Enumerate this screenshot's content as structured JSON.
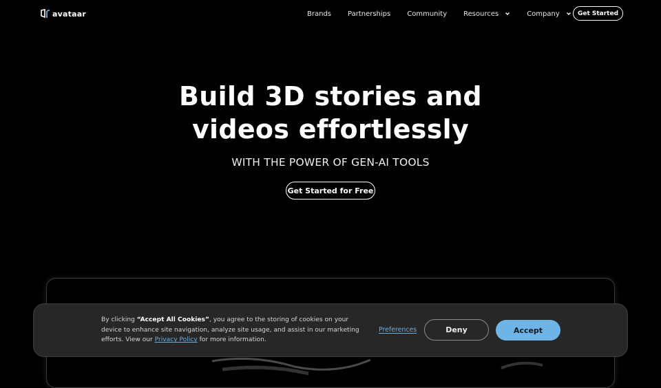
{
  "brand": {
    "name": "avataar"
  },
  "nav": {
    "links": [
      {
        "label": "Brands",
        "has_dropdown": false
      },
      {
        "label": "Partnerships",
        "has_dropdown": false
      },
      {
        "label": "Community",
        "has_dropdown": false
      },
      {
        "label": "Resources",
        "has_dropdown": true
      },
      {
        "label": "Company",
        "has_dropdown": true
      }
    ],
    "cta_label": "Get Started"
  },
  "hero": {
    "title_line1": "Build 3D stories and",
    "title_line2": "videos effortlessly",
    "subtitle": "WITH THE POWER OF GEN-AI TOOLS",
    "cta_label": "Get Started for Free"
  },
  "cookie_banner": {
    "text_prefix": "By clicking ",
    "text_bold": "“Accept All Cookies”",
    "text_middle": ", you agree to the storing of cookies on your device to enhance site navigation, analyze site usage, and assist in our marketing efforts. View our ",
    "privacy_link": "Privacy Policy",
    "text_suffix": " for more information.",
    "preferences_label": "Preferences",
    "deny_label": "Deny",
    "accept_label": "Accept",
    "accent_color": "#6fb4e6"
  }
}
